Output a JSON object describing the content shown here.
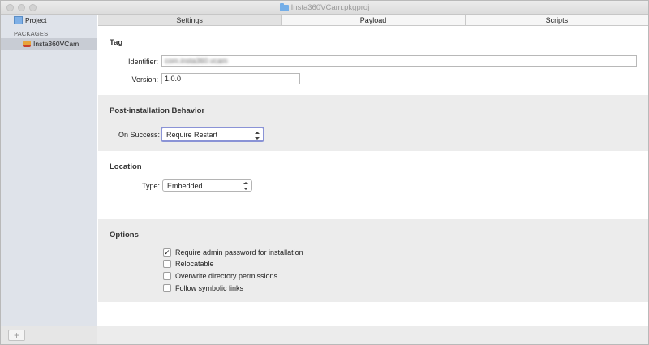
{
  "window": {
    "title": "Insta360VCam.pkgproj"
  },
  "sidebar": {
    "project_label": "Project",
    "packages_heading": "PACKAGES",
    "package_item": "Insta360VCam"
  },
  "tabs": [
    {
      "label": "Settings",
      "active": true
    },
    {
      "label": "Payload",
      "active": false
    },
    {
      "label": "Scripts",
      "active": false
    }
  ],
  "tag": {
    "title": "Tag",
    "identifier_label": "Identifier:",
    "identifier_value": "com.insta360.vcam",
    "version_label": "Version:",
    "version_value": "1.0.0"
  },
  "post_install": {
    "title": "Post-installation Behavior",
    "on_success_label": "On Success:",
    "on_success_value": "Require Restart"
  },
  "location": {
    "title": "Location",
    "type_label": "Type:",
    "type_value": "Embedded"
  },
  "options": {
    "title": "Options",
    "items": [
      {
        "label": "Require admin password for installation",
        "checked": true,
        "mark": "✓"
      },
      {
        "label": "Relocatable",
        "checked": false,
        "mark": ""
      },
      {
        "label": "Overwrite directory permissions",
        "checked": false,
        "mark": ""
      },
      {
        "label": "Follow symbolic links",
        "checked": false,
        "mark": ""
      }
    ]
  },
  "bottom": {
    "add_label": "+"
  },
  "colors": {
    "sidebar_bg": "#dfe3ea",
    "section_gray": "#ececec",
    "focus_ring": "#8a93d6",
    "folder_blue": "#74aee8"
  }
}
